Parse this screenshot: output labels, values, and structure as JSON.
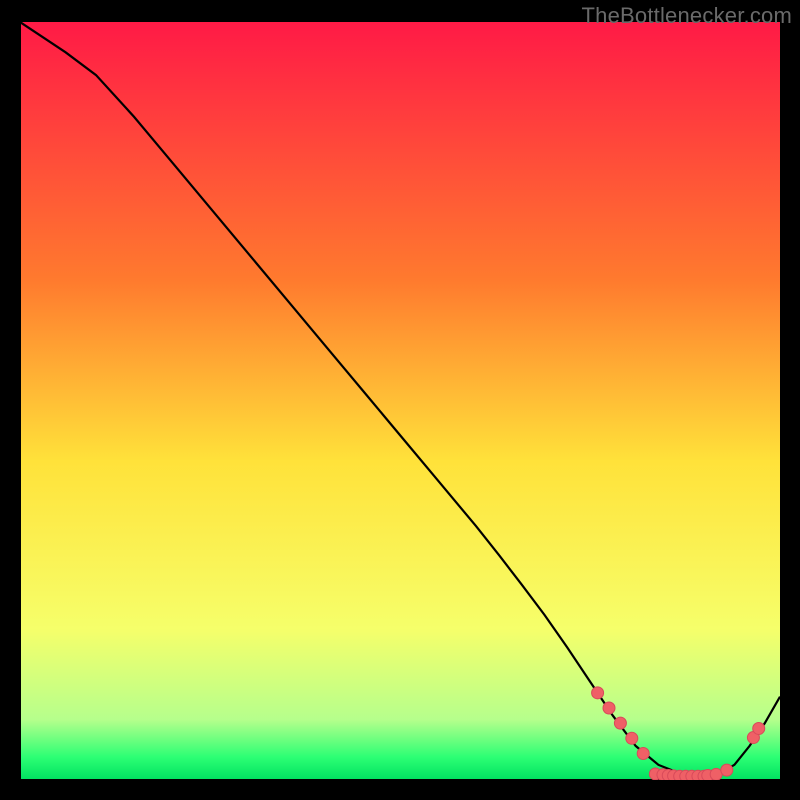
{
  "watermark": "TheBottlenecker.com",
  "colors": {
    "bg": "#000000",
    "axis": "#000000",
    "curve": "#000000",
    "marker_fill": "#ef6066",
    "marker_stroke": "#d84a5a",
    "grad_top": "#ff1a46",
    "grad_mid_top": "#ff7a2e",
    "grad_mid": "#ffe23a",
    "grad_low": "#f6ff6a",
    "grad_green_light": "#b6ff8c",
    "grad_green": "#2cff74",
    "grad_green_edge": "#00e060"
  },
  "chart_data": {
    "type": "line",
    "title": "",
    "xlabel": "",
    "ylabel": "",
    "xlim": [
      0,
      100
    ],
    "ylim": [
      0,
      100
    ],
    "curve": {
      "x": [
        0,
        6,
        10,
        15,
        20,
        25,
        30,
        35,
        40,
        45,
        50,
        55,
        60,
        63,
        66,
        69,
        72,
        75,
        78,
        81,
        84,
        87,
        90,
        92,
        94,
        96,
        98,
        100
      ],
      "y": [
        100,
        96,
        93,
        87.5,
        81.5,
        75.5,
        69.5,
        63.5,
        57.5,
        51.5,
        45.5,
        39.5,
        33.5,
        29.7,
        25.8,
        21.8,
        17.5,
        13,
        8.5,
        4.5,
        2.0,
        0.8,
        0.5,
        0.8,
        2.0,
        4.5,
        7.5,
        11.0
      ]
    },
    "markers": [
      {
        "x": 76.0,
        "y": 11.5
      },
      {
        "x": 77.5,
        "y": 9.5
      },
      {
        "x": 79.0,
        "y": 7.5
      },
      {
        "x": 80.5,
        "y": 5.5
      },
      {
        "x": 82.0,
        "y": 3.5
      },
      {
        "x": 83.6,
        "y": 0.8
      },
      {
        "x": 84.6,
        "y": 0.7
      },
      {
        "x": 85.3,
        "y": 0.6
      },
      {
        "x": 86.0,
        "y": 0.55
      },
      {
        "x": 86.8,
        "y": 0.5
      },
      {
        "x": 87.6,
        "y": 0.5
      },
      {
        "x": 88.4,
        "y": 0.5
      },
      {
        "x": 89.2,
        "y": 0.5
      },
      {
        "x": 90.0,
        "y": 0.5
      },
      {
        "x": 90.5,
        "y": 0.6
      },
      {
        "x": 91.6,
        "y": 0.75
      },
      {
        "x": 93.0,
        "y": 1.3
      },
      {
        "x": 96.5,
        "y": 5.6
      },
      {
        "x": 97.2,
        "y": 6.8
      }
    ]
  }
}
